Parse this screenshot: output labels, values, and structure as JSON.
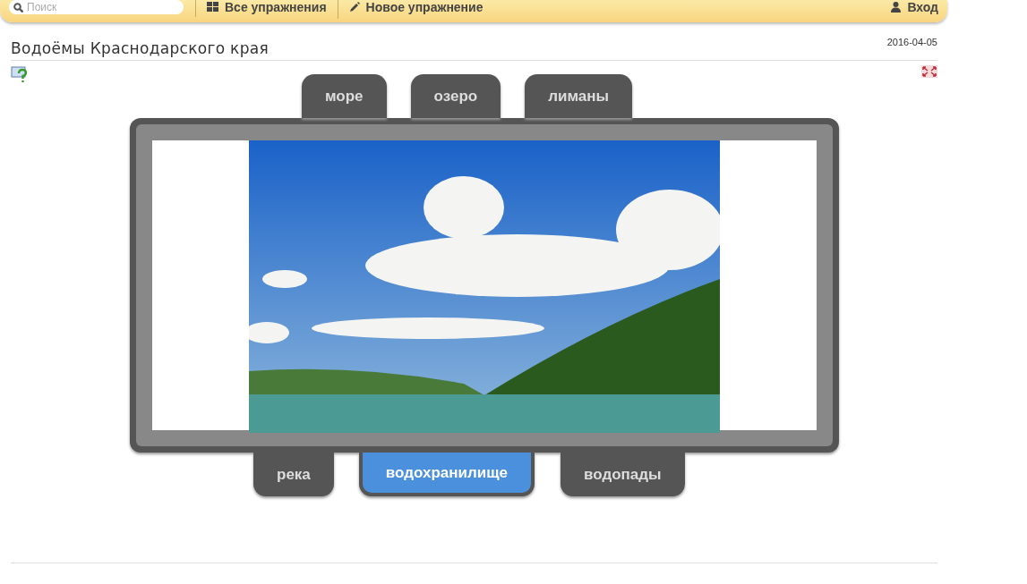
{
  "navbar": {
    "search": {
      "placeholder": "Поиск"
    },
    "links": [
      {
        "kind": "grid",
        "label": "Все упражнения"
      },
      {
        "kind": "pencil",
        "label": "Новое упражнение"
      }
    ],
    "login": "Вход"
  },
  "page": {
    "title": "Водоёмы Краснодарского края",
    "date": "2016-04-05"
  },
  "tabs_top": [
    {
      "label": "море",
      "selected": false
    },
    {
      "label": "озеро",
      "selected": false
    },
    {
      "label": "лиманы",
      "selected": false
    }
  ],
  "tabs_bottom": [
    {
      "label": "река",
      "selected": false
    },
    {
      "label": "водохранилище",
      "selected": true
    },
    {
      "label": "водопады",
      "selected": false
    }
  ]
}
